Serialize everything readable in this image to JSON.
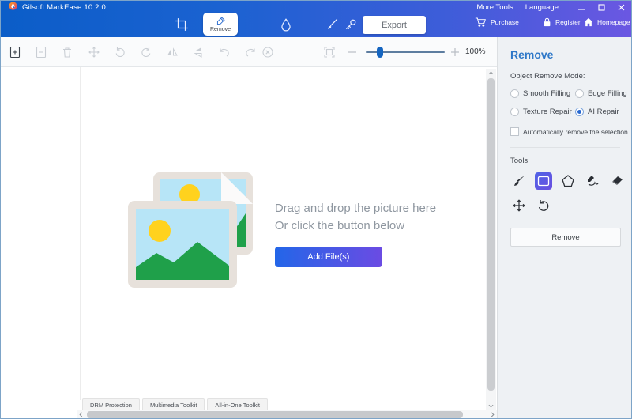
{
  "window": {
    "title": "Gilsoft MarkEase 10.2.0",
    "menu_more_tools": "More Tools",
    "menu_language": "Language"
  },
  "header": {
    "nav_remove_label": "Remove",
    "export_label": "Export",
    "links": [
      {
        "label": "Purchase",
        "icon": "cart-icon"
      },
      {
        "label": "Register",
        "icon": "lock-icon"
      },
      {
        "label": "Homepage",
        "icon": "home-icon"
      }
    ]
  },
  "toolbar": {
    "zoom_level": "100%",
    "icons": [
      "add-file",
      "remove-file",
      "delete",
      "move",
      "rotate-left",
      "rotate-right",
      "flip-horizontal",
      "flip-vertical",
      "undo",
      "redo",
      "deselect",
      "fit-to-window",
      "zoom-out",
      "zoom-in"
    ]
  },
  "canvas": {
    "drop_line1": "Drag and drop the picture here",
    "drop_line2": "Or click the button below",
    "add_button_label": "Add File(s)"
  },
  "panel": {
    "title": "Remove",
    "mode_label": "Object Remove Mode:",
    "modes": [
      {
        "label": "Smooth Filling",
        "selected": false
      },
      {
        "label": "Edge Filling",
        "selected": false
      },
      {
        "label": "Texture Repair",
        "selected": false
      },
      {
        "label": "AI Repair",
        "selected": true
      }
    ],
    "auto_checkbox_label": "Automatically remove the selection",
    "auto_checkbox_checked": false,
    "tools_label": "Tools:",
    "tools": [
      "brush",
      "rect-select",
      "polygon",
      "smart-pen",
      "eraser",
      "move",
      "reset-rotate"
    ],
    "active_tool": "rect-select",
    "remove_button_label": "Remove"
  },
  "tabs": [
    "DRM Protection",
    "Multimedia Toolkit",
    "All-in-One Toolkit"
  ],
  "colors": {
    "header_gradient_start": "#0b5dc8",
    "header_gradient_end": "#6b57e2",
    "panel_title_blue": "#2e78c8",
    "radio_selected_blue": "#2667d0",
    "add_button_gradient": [
      "#2366e8",
      "#6b4be3"
    ],
    "active_tool_gradient": [
      "#4f63e6",
      "#6a4fe0"
    ],
    "slider_handle_blue": "#1565c0"
  }
}
